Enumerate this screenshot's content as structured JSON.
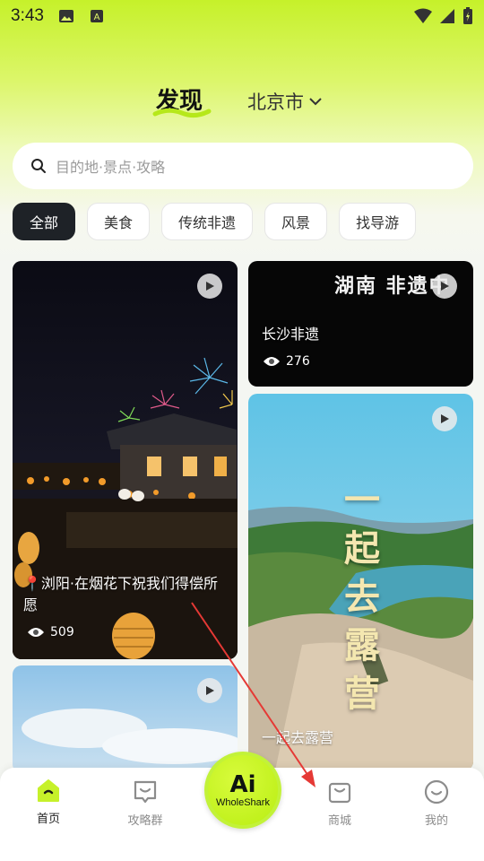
{
  "status_bar": {
    "time": "3:43"
  },
  "header": {
    "title": "发现",
    "city": "北京市"
  },
  "search": {
    "placeholder": "目的地·景点·攻略"
  },
  "categories": [
    "全部",
    "美食",
    "传统非遗",
    "风景",
    "找导游"
  ],
  "cards": [
    {
      "title": "📍浏阳·在烟花下祝我们得偿所愿",
      "views": "509"
    },
    {
      "title": "长沙非遗",
      "views": "276",
      "overlay": "湖南 非遗中"
    },
    {
      "title": "一起去露营",
      "overlay": "一起去露营"
    }
  ],
  "nav": {
    "home": "首页",
    "guide_group": "攻略群",
    "center_ai": "Ai",
    "center_brand": "WholeShark",
    "mall": "商城",
    "mine": "我的"
  },
  "colors": {
    "accent": "#c6f12a",
    "chip_active": "#1e2227",
    "annotation_arrow": "#e53935"
  }
}
